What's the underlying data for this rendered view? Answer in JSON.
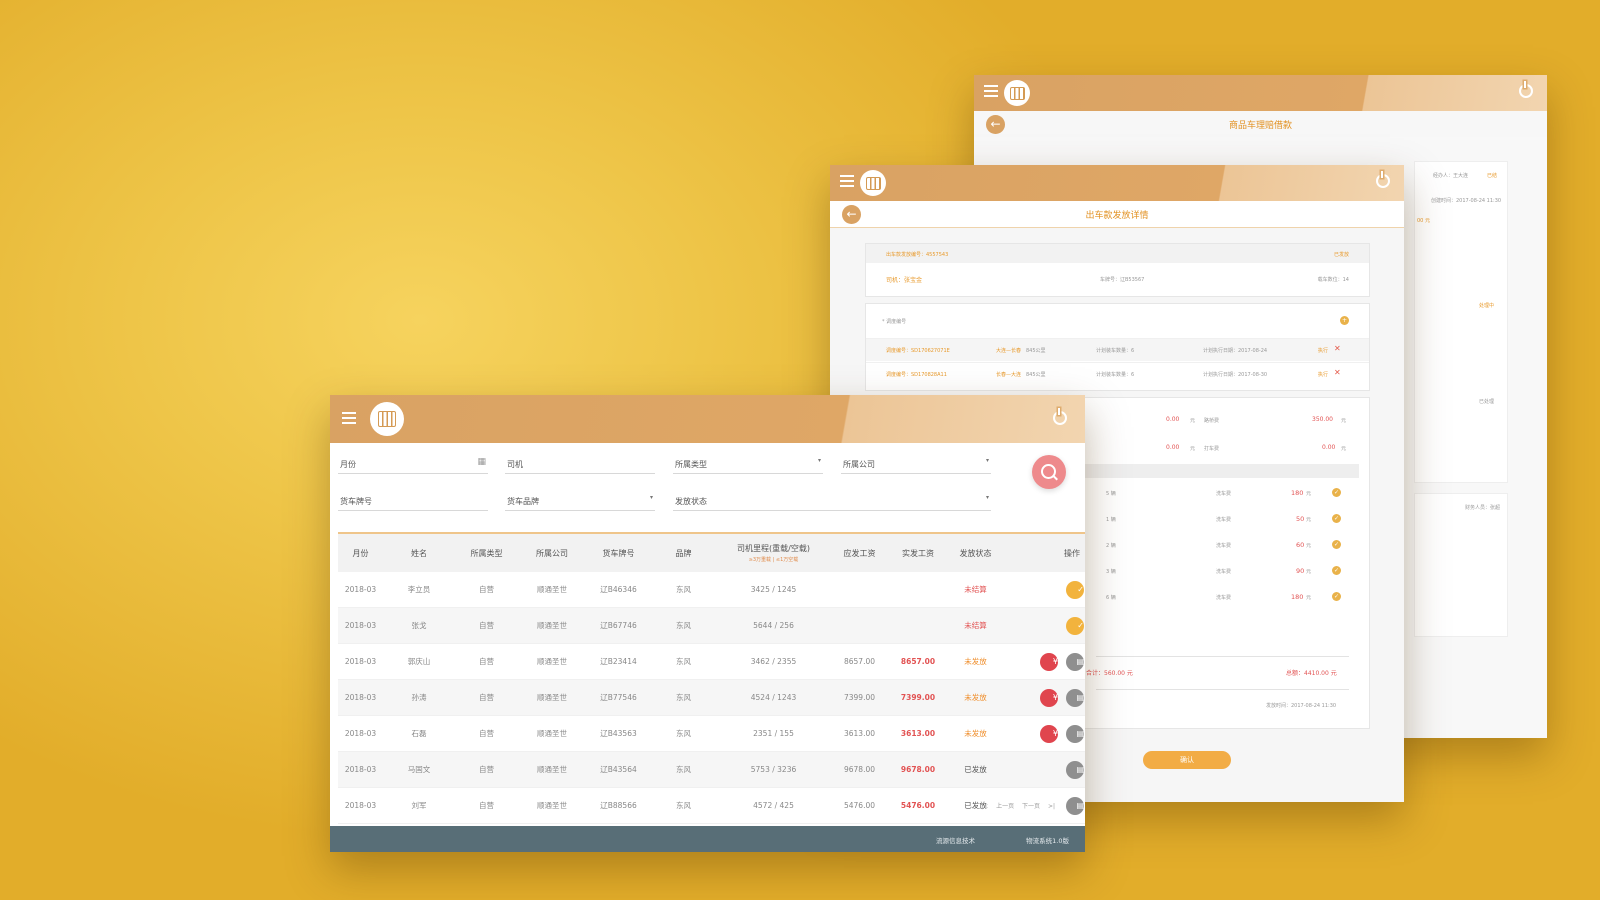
{
  "back_window": {
    "title": "商品车理赔借款",
    "labels": [
      "经办人：王大连",
      "已结",
      "创建时间：2017-08-24 11:30",
      "00 元",
      "处理中",
      "已处理",
      "财务人员：张超"
    ]
  },
  "detail_window": {
    "title": "出车款发放详情",
    "order_no": "出车款发放编号：4557543",
    "order_status": "已发放",
    "driver": "司机：张宝金",
    "plate": "车牌号：辽B53567",
    "seats": "载车数位：14",
    "dispatch_label": "* 调度编号",
    "dispatches": [
      {
        "no": "调度编号：SD170627071E",
        "route": "大连—长春",
        "distance": "845公里",
        "count": "计划装车数量：6",
        "date": "计划执行日期：2017-08-24",
        "action": "执行"
      },
      {
        "no": "调度编号：SD170828A11",
        "route": "长春—大连",
        "distance": "845公里",
        "count": "计划装车数量：6",
        "date": "计划执行日期：2017-08-30",
        "action": "执行"
      }
    ],
    "fees": [
      {
        "value": "0.00",
        "unit": "元",
        "label": "路桥费",
        "value2": "350.00",
        "unit2": "元"
      },
      {
        "value": "0.00",
        "unit": "元",
        "label": "打车费",
        "value2": "0.00",
        "unit2": "元"
      }
    ],
    "wash_rows": [
      {
        "no": "5 辆",
        "label": "洗车费",
        "value": "180",
        "unit": "元"
      },
      {
        "no": "1 辆",
        "label": "洗车费",
        "value": "50",
        "unit": "元"
      },
      {
        "no": "2 辆",
        "label": "洗车费",
        "value": "60",
        "unit": "元"
      },
      {
        "no": "3 辆",
        "label": "洗车费",
        "value": "90",
        "unit": "元"
      },
      {
        "no": "6 辆",
        "label": "洗车费",
        "value": "180",
        "unit": "元"
      }
    ],
    "subtotal": "合计：560.00 元",
    "total": "总额：4410.00 元",
    "created": "发放时间：2017-08-24 11:30",
    "confirm_label": "确认"
  },
  "main_window": {
    "filters": {
      "month": "月份",
      "driver": "司机",
      "type": "所属类型",
      "company": "所属公司",
      "plate": "货车牌号",
      "brand": "货车品牌",
      "status": "发放状态"
    },
    "columns": [
      "月份",
      "姓名",
      "所属类型",
      "所属公司",
      "货车牌号",
      "品牌",
      "司机里程(重载/空载)",
      "应发工资",
      "实发工资",
      "发放状态",
      "操作"
    ],
    "mileage_sub": "≥3万重载 | ≤1万空载",
    "rows": [
      {
        "month": "2018-03",
        "name": "李立员",
        "type": "自营",
        "company": "顺通圣世",
        "plate": "辽B46346",
        "brand": "东风",
        "mileage": "3425 / 1245",
        "due": "",
        "paid": "",
        "status": "未结算",
        "status_kind": "unsettled",
        "ops": [
          "ok"
        ]
      },
      {
        "month": "2018-03",
        "name": "张戈",
        "type": "自营",
        "company": "顺通圣世",
        "plate": "辽B67746",
        "brand": "东风",
        "mileage": "5644 / 256",
        "due": "",
        "paid": "",
        "status": "未结算",
        "status_kind": "unsettled",
        "ops": [
          "ok"
        ]
      },
      {
        "month": "2018-03",
        "name": "郭庆山",
        "type": "自营",
        "company": "顺通圣世",
        "plate": "辽B23414",
        "brand": "东风",
        "mileage": "3462 / 2355",
        "due": "8657.00",
        "paid": "8657.00",
        "status": "未发放",
        "status_kind": "pending",
        "ops": [
          "yen",
          "doc"
        ]
      },
      {
        "month": "2018-03",
        "name": "孙涛",
        "type": "自营",
        "company": "顺通圣世",
        "plate": "辽B77546",
        "brand": "东风",
        "mileage": "4524 / 1243",
        "due": "7399.00",
        "paid": "7399.00",
        "status": "未发放",
        "status_kind": "pending",
        "ops": [
          "yen",
          "doc"
        ]
      },
      {
        "month": "2018-03",
        "name": "石磊",
        "type": "自营",
        "company": "顺通圣世",
        "plate": "辽B43563",
        "brand": "东风",
        "mileage": "2351 / 155",
        "due": "3613.00",
        "paid": "3613.00",
        "status": "未发放",
        "status_kind": "pending",
        "ops": [
          "yen",
          "doc"
        ]
      },
      {
        "month": "2018-03",
        "name": "马国文",
        "type": "自营",
        "company": "顺通圣世",
        "plate": "辽B43564",
        "brand": "东风",
        "mileage": "5753 / 3236",
        "due": "9678.00",
        "paid": "9678.00",
        "status": "已发放",
        "status_kind": "done",
        "ops": [
          "doc"
        ]
      },
      {
        "month": "2018-03",
        "name": "刘军",
        "type": "自营",
        "company": "顺通圣世",
        "plate": "辽B88566",
        "brand": "东风",
        "mileage": "4572 / 425",
        "due": "5476.00",
        "paid": "5476.00",
        "status": "已发放",
        "status_kind": "done",
        "ops": [
          "doc"
        ]
      }
    ],
    "pager": {
      "first": "|<",
      "prev": "上一页",
      "next": "下一页",
      "last": ">|"
    },
    "footer": {
      "company": "流源信息技术",
      "system": "物流系统1.0版"
    }
  },
  "colors": {
    "background": "#e9bb3a",
    "topbar": "#d9a263",
    "accent_orange": "#f2ac45",
    "accent_red": "#e0454e",
    "footer": "#586e77"
  }
}
